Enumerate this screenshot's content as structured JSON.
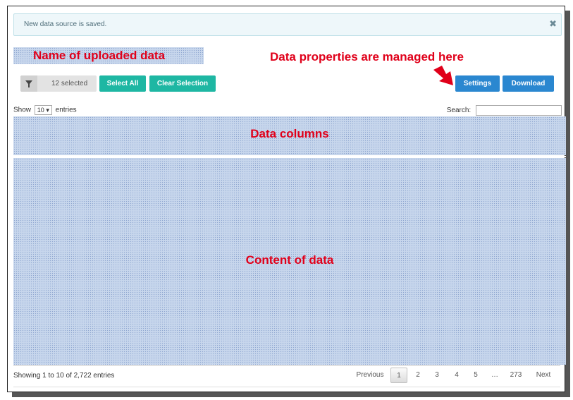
{
  "alert": {
    "message": "New data source is saved.",
    "close_glyph": "✖"
  },
  "annotations": {
    "dataset_name": "Name of uploaded data",
    "data_properties": "Data properties are managed here",
    "data_columns": "Data columns",
    "content": "Content of data",
    "annotation_color": "#e0001a"
  },
  "toolbar": {
    "filter_icon": "filter-icon",
    "selected_count": "12 selected",
    "select_all": "Select All",
    "clear_selection": "Clear Selection",
    "settings": "Settings",
    "download": "Download",
    "accent_teal": "#1eb7a3",
    "accent_blue": "#2a87d0"
  },
  "table_controls": {
    "show_label": "Show",
    "page_size": "10",
    "entries_label": "entries",
    "search_label": "Search:",
    "search_value": ""
  },
  "footer": {
    "info": "Showing 1 to 10 of 2,722 entries",
    "previous": "Previous",
    "pages": [
      "1",
      "2",
      "3",
      "4",
      "5",
      "…",
      "273"
    ],
    "current_page": "1",
    "next": "Next"
  }
}
